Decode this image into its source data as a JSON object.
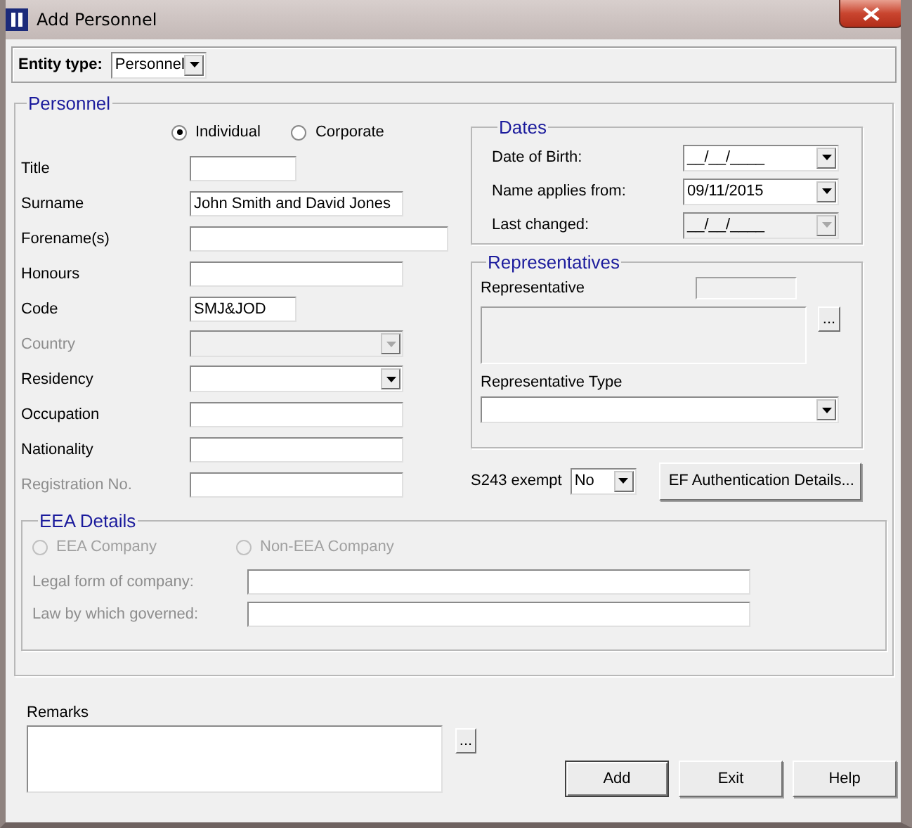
{
  "window": {
    "title": "Add Personnel"
  },
  "entity_type": {
    "label": "Entity type:",
    "value": "Personnel"
  },
  "personnel": {
    "legend": "Personnel",
    "person_type": [
      {
        "label": "Individual",
        "selected": true
      },
      {
        "label": "Corporate",
        "selected": false
      }
    ],
    "fields": [
      {
        "label": "Title",
        "kind": "short",
        "disabled": false
      },
      {
        "label": "Surname",
        "kind": "text",
        "value": "John Smith and David Jones",
        "disabled": false
      },
      {
        "label": "Forename(s)",
        "kind": "wide",
        "disabled": false
      },
      {
        "label": "Honours",
        "kind": "text",
        "disabled": false
      },
      {
        "label": "Code",
        "kind": "short",
        "value": "SMJ&JOD",
        "disabled": false
      },
      {
        "label": "Country",
        "kind": "combo",
        "disabled": true
      },
      {
        "label": "Residency",
        "kind": "combo",
        "disabled": false
      },
      {
        "label": "Occupation",
        "kind": "text",
        "disabled": false
      },
      {
        "label": "Nationality",
        "kind": "text",
        "disabled": false
      },
      {
        "label": "Registration No.",
        "kind": "text",
        "disabled": true
      }
    ]
  },
  "dates": {
    "legend": "Dates",
    "rows": [
      {
        "label": "Date of Birth:",
        "value": "__/__/____",
        "disabled": false
      },
      {
        "label": "Name applies from:",
        "value": "09/11/2015",
        "disabled": false
      },
      {
        "label": "Last changed:",
        "value": "__/__/____",
        "disabled": true
      }
    ]
  },
  "representatives": {
    "legend": "Representatives",
    "representative_label": "Representative",
    "browse_button": "...",
    "type_label": "Representative Type"
  },
  "s243_exempt": {
    "label": "S243 exempt",
    "value": "No"
  },
  "ef_button": "EF Authentication Details...",
  "eea": {
    "legend": "EEA Details",
    "company_type": [
      {
        "label": "EEA Company",
        "selected": false,
        "disabled": true
      },
      {
        "label": "Non-EEA Company",
        "selected": false,
        "disabled": true
      }
    ],
    "fields": [
      {
        "label": "Legal form of company:"
      },
      {
        "label": "Law by which governed:"
      }
    ]
  },
  "remarks": {
    "label": "Remarks",
    "browse_button": "..."
  },
  "buttons": [
    "Add",
    "Exit",
    "Help"
  ]
}
